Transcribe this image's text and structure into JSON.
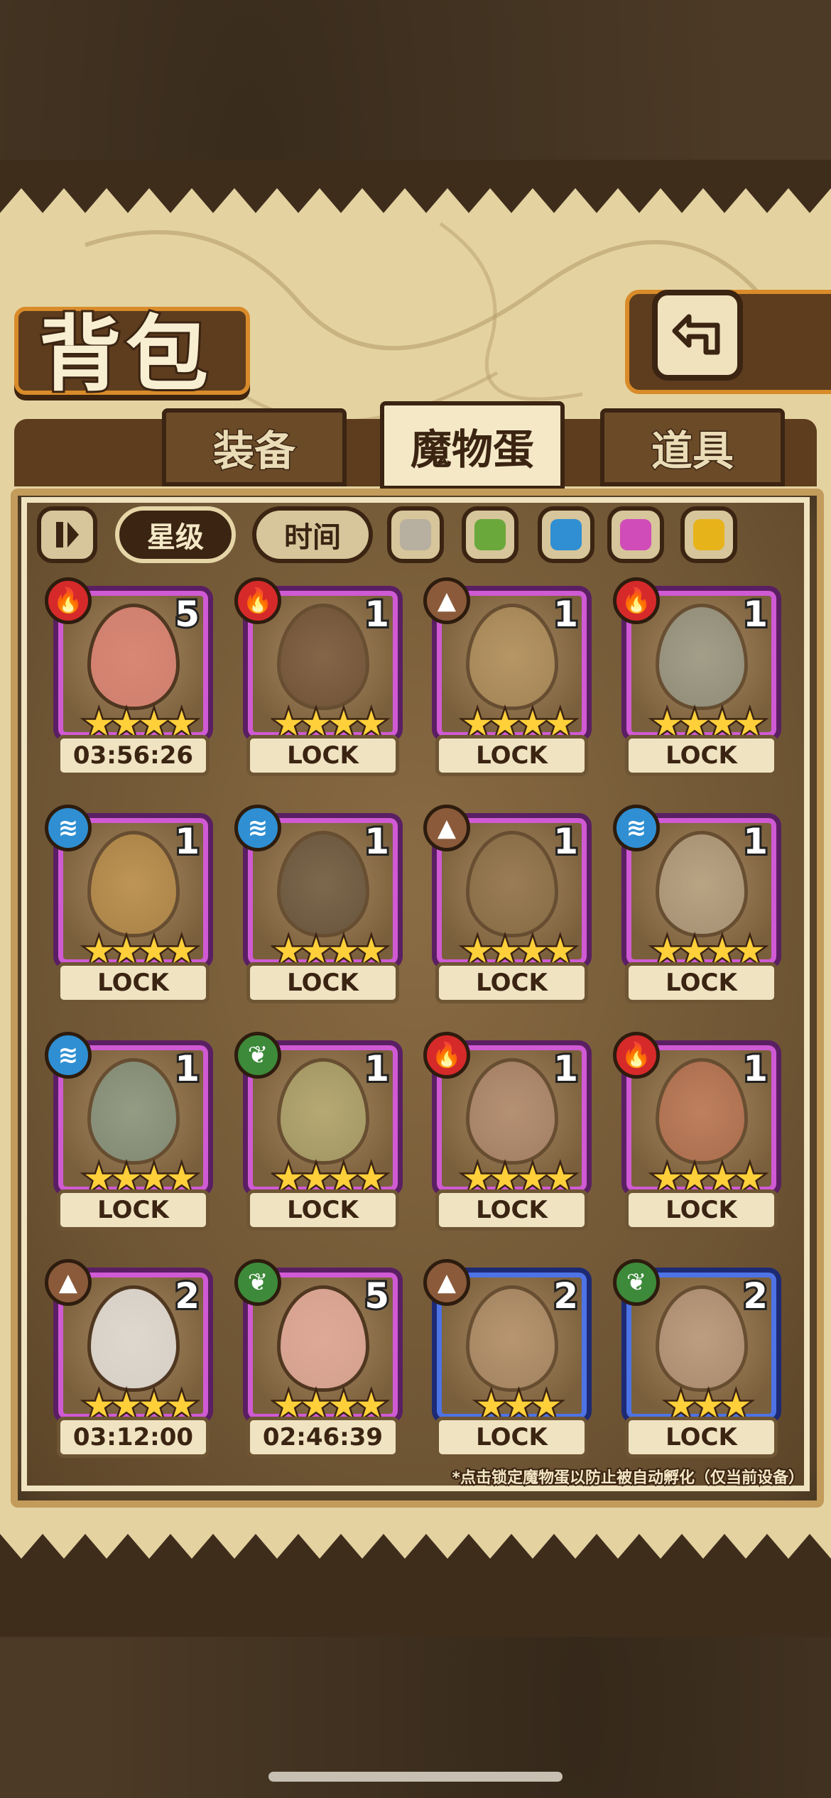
{
  "header": {
    "title": "背包",
    "back_icon": "return-arrow-icon"
  },
  "tabs": [
    {
      "label": "装备",
      "active": false
    },
    {
      "label": "魔物蛋",
      "active": true
    },
    {
      "label": "道具",
      "active": false
    }
  ],
  "filters": {
    "sort_toggle_icon": "pause-sort-icon",
    "sort_star": "星级",
    "sort_time": "时间",
    "colors": [
      {
        "name": "gray",
        "hex": "#b7b0a0"
      },
      {
        "name": "green",
        "hex": "#6aa83b"
      },
      {
        "name": "blue",
        "hex": "#2f8fd2"
      },
      {
        "name": "pink",
        "hex": "#d04cb8"
      },
      {
        "name": "yellow",
        "hex": "#e7b31a"
      }
    ]
  },
  "element_colors": {
    "fire": "#d62a2a",
    "water": "#2f8fd2",
    "earth": "#8a5a3a",
    "nature": "#3d8a3a"
  },
  "eggs": [
    {
      "element": "fire",
      "count": "5",
      "stars": "★★★★",
      "status": "03:56:26",
      "rarity": "purple",
      "color": "#e9877c"
    },
    {
      "element": "fire",
      "count": "1",
      "stars": "★★★★",
      "status": "LOCK",
      "rarity": "purple",
      "color": "#5a3a2a"
    },
    {
      "element": "earth",
      "count": "1",
      "stars": "★★★★",
      "status": "LOCK",
      "rarity": "purple",
      "color": "#c9a66b"
    },
    {
      "element": "fire",
      "count": "1",
      "stars": "★★★★",
      "status": "LOCK",
      "rarity": "purple",
      "color": "#9fb8b8"
    },
    {
      "element": "water",
      "count": "1",
      "stars": "★★★★",
      "status": "LOCK",
      "rarity": "purple",
      "color": "#d9a34a"
    },
    {
      "element": "water",
      "count": "1",
      "stars": "★★★★",
      "status": "LOCK",
      "rarity": "purple",
      "color": "#4a4036"
    },
    {
      "element": "earth",
      "count": "1",
      "stars": "★★★★",
      "status": "LOCK",
      "rarity": "purple",
      "color": "#8a7048"
    },
    {
      "element": "water",
      "count": "1",
      "stars": "★★★★",
      "status": "LOCK",
      "rarity": "purple",
      "color": "#cfc3ae"
    },
    {
      "element": "water",
      "count": "1",
      "stars": "★★★★",
      "status": "LOCK",
      "rarity": "purple",
      "color": "#7fb2ad"
    },
    {
      "element": "nature",
      "count": "1",
      "stars": "★★★★",
      "status": "LOCK",
      "rarity": "purple",
      "color": "#c6cf8a"
    },
    {
      "element": "fire",
      "count": "1",
      "stars": "★★★★",
      "status": "LOCK",
      "rarity": "purple",
      "color": "#c79a8a"
    },
    {
      "element": "fire",
      "count": "1",
      "stars": "★★★★",
      "status": "LOCK",
      "rarity": "purple",
      "color": "#d9745a"
    },
    {
      "element": "earth",
      "count": "2",
      "stars": "★★★★",
      "status": "03:12:00",
      "rarity": "purple",
      "color": "#f2f2f2"
    },
    {
      "element": "nature",
      "count": "5",
      "stars": "★★★★",
      "status": "02:46:39",
      "rarity": "purple",
      "color": "#f0b4a8"
    },
    {
      "element": "earth",
      "count": "2",
      "stars": "★★★",
      "status": "LOCK",
      "rarity": "blue",
      "color": "#c9a484"
    },
    {
      "element": "nature",
      "count": "2",
      "stars": "★★★",
      "status": "LOCK",
      "rarity": "blue",
      "color": "#d9b6a4"
    }
  ],
  "hint": "*点击锁定魔物蛋以防止被自动孵化（仅当前设备）"
}
